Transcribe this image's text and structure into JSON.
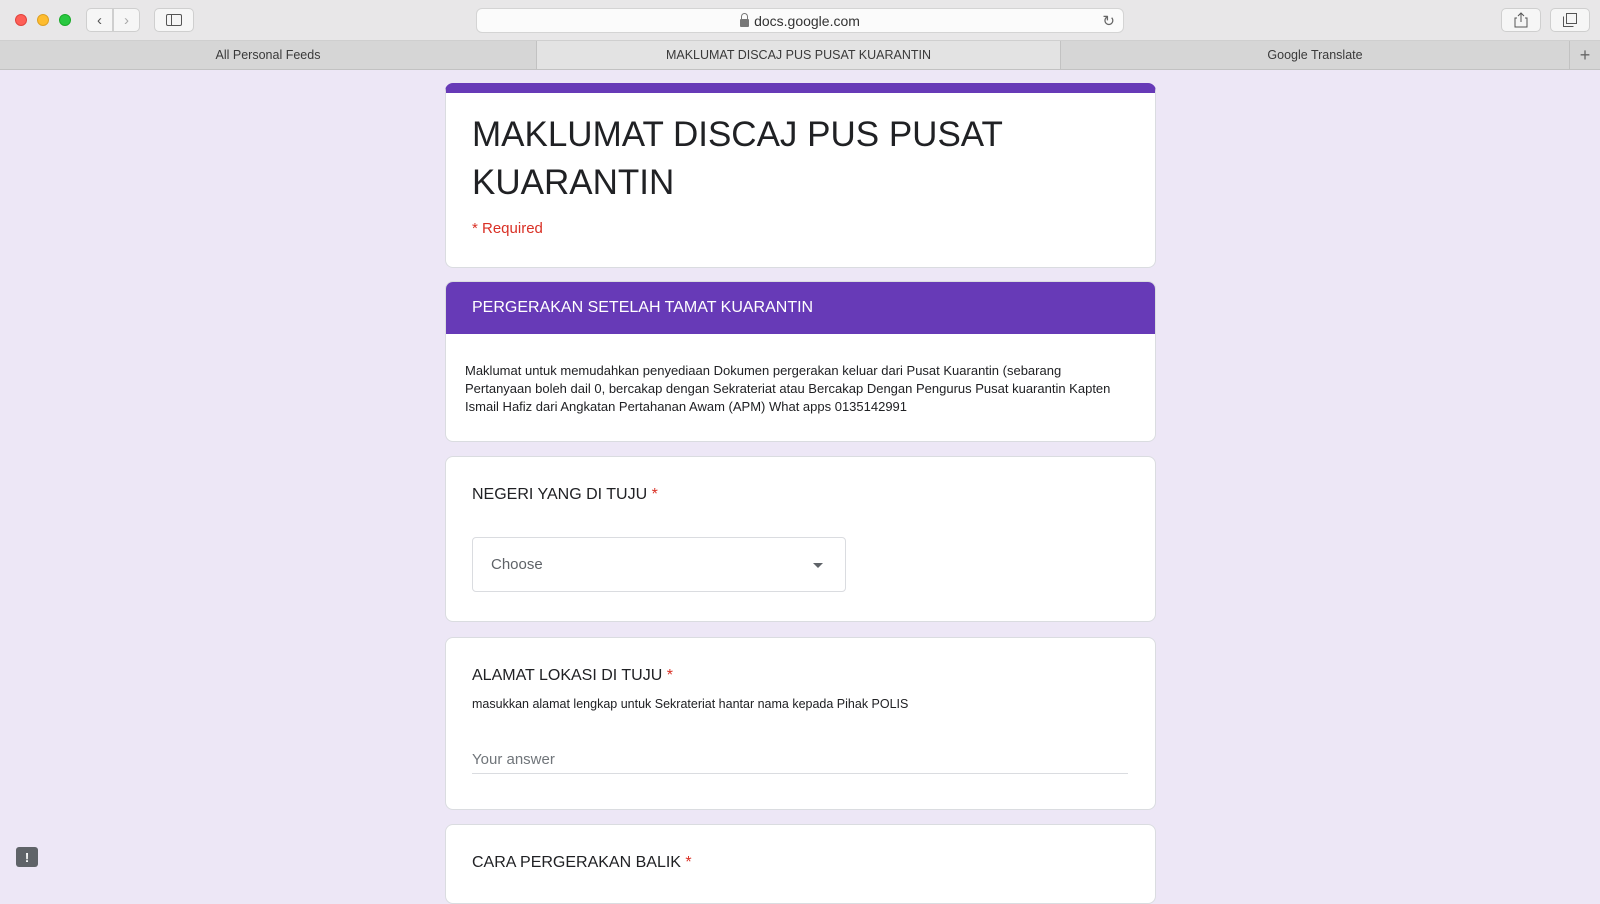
{
  "browser": {
    "url": "docs.google.com",
    "tabs": [
      {
        "label": "All Personal Feeds"
      },
      {
        "label": "MAKLUMAT DISCAJ PUS PUSAT KUARANTIN"
      },
      {
        "label": "Google Translate"
      }
    ],
    "active_tab": 1
  },
  "form": {
    "title": "MAKLUMAT DISCAJ PUS PUSAT KUARANTIN",
    "required_note": "* Required",
    "accent_color": "#673ab7",
    "section": {
      "title": "PERGERAKAN SETELAH TAMAT KUARANTIN",
      "description": "Maklumat untuk memudahkan penyediaan Dokumen pergerakan keluar dari Pusat Kuarantin (sebarang Pertanyaan boleh dail 0, bercakap dengan Sekrateriat atau Bercakap Dengan Pengurus Pusat kuarantin Kapten Ismail Hafiz dari Angkatan Pertahanan Awam (APM) What apps 0135142991"
    },
    "questions": [
      {
        "title": "NEGERI YANG DI TUJU",
        "required_mark": "*",
        "select_value": "Choose"
      },
      {
        "title": "ALAMAT LOKASI DI TUJU",
        "required_mark": "*",
        "help": "masukkan alamat lengkap untuk Sekrateriat hantar nama kepada Pihak POLIS",
        "placeholder": "Your answer",
        "value": ""
      },
      {
        "title": "CARA PERGERAKAN BALIK",
        "required_mark": "*"
      }
    ]
  },
  "icons": {
    "back": "chevron-left-icon",
    "forward": "chevron-right-icon",
    "sidebar": "sidebar-icon",
    "lock": "lock-icon",
    "reload": "reload-icon",
    "share": "share-icon",
    "tabs": "tabs-overview-icon",
    "new_tab": "plus-icon",
    "dropdown": "dropdown-arrow-icon",
    "feedback": "feedback-icon",
    "feedback_glyph": "!"
  }
}
